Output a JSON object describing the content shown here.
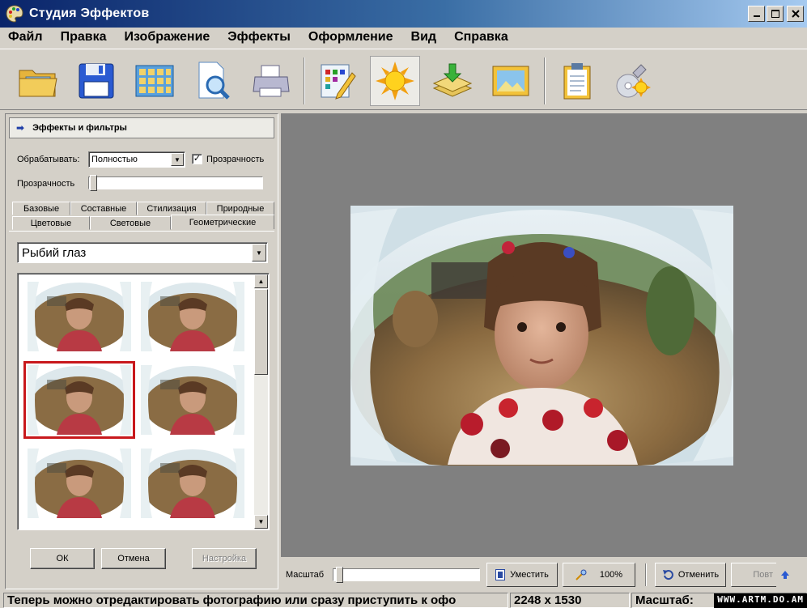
{
  "window": {
    "title": "Студия Эффектов"
  },
  "menu": [
    "Файл",
    "Правка",
    "Изображение",
    "Эффекты",
    "Оформление",
    "Вид",
    "Справка"
  ],
  "toolbar": {
    "icons": [
      "open-folder-icon",
      "save-floppy-icon",
      "grid-layout-icon",
      "document-search-icon",
      "printer-icon",
      "edit-palette-icon",
      "effects-sun-icon",
      "import-layers-icon",
      "image-frame-icon",
      "clipboard-icon",
      "disc-settings-icon"
    ],
    "active": "effects-sun-icon"
  },
  "panel": {
    "header": "Эффекты и фильтры",
    "process_label": "Обрабатывать:",
    "process_value": "Полностью",
    "transparency_check_label": "Прозрачность",
    "transparency_checked": true,
    "transparency_label": "Прозрачность",
    "transparency_level": 0,
    "tabs_row1": [
      "Базовые",
      "Составные",
      "Стилизация",
      "Природные"
    ],
    "tabs_row2": [
      "Цветовые",
      "Световые",
      "Геометрические"
    ],
    "active_tab": "Геометрические",
    "effect_value": "Рыбий глаз",
    "selected_thumbnail": 3,
    "buttons": {
      "ok": "ОК",
      "cancel": "Отмена",
      "settings": "Настройка"
    }
  },
  "zoom": {
    "label": "Масштаб",
    "fit": "Уместить",
    "percent": "100%",
    "undo": "Отменить",
    "redo": "Повт"
  },
  "status": {
    "message": "Теперь можно отредактировать фотографию или сразу приступить к офо",
    "size": "2248 x 1530",
    "scale": "Масштаб: "
  },
  "watermark": "WWW.ARTM.DO.AM",
  "colors": {
    "selection": "#c8181c",
    "titlebar": "#0a246a",
    "canvas": "#808080"
  }
}
